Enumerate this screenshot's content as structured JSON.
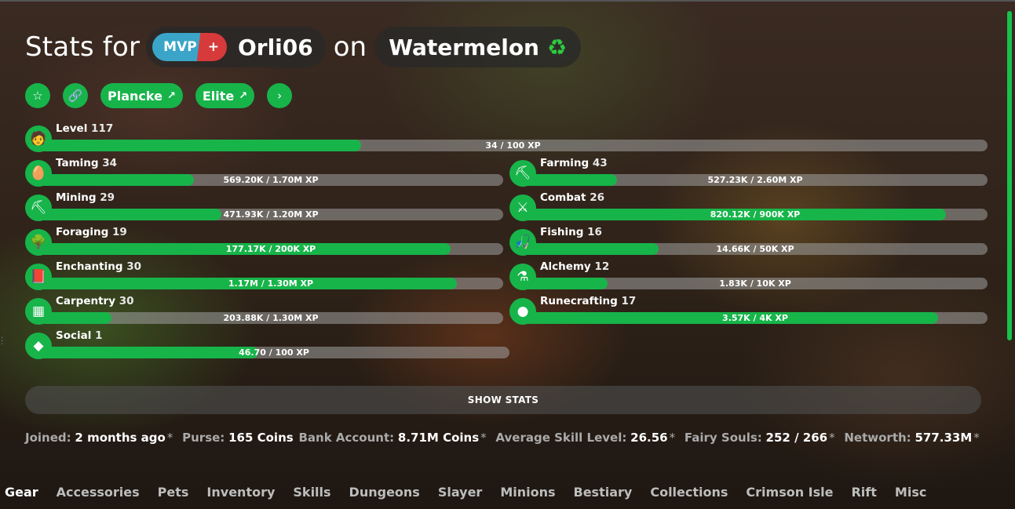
{
  "header": {
    "stats_for": "Stats for",
    "rank_main": "MVP",
    "rank_plus": "+",
    "player": "Orli06",
    "on": "on",
    "profile": "Watermelon",
    "profile_icon": "recycle-icon"
  },
  "buttons": [
    {
      "icon": "star-icon"
    },
    {
      "icon": "link-icon"
    },
    {
      "label": "Plancke"
    },
    {
      "label": "Elite"
    },
    {
      "icon": "chevron-right-icon"
    }
  ],
  "skills": {
    "level": {
      "name": "Level",
      "level": "117",
      "xp": "34 / 100 XP",
      "progress": 0.34
    },
    "taming": {
      "name": "Taming",
      "level": "34",
      "xp": "569.20K / 1.70M XP",
      "progress": 0.335
    },
    "farming": {
      "name": "Farming",
      "level": "43",
      "xp": "527.23K / 2.60M XP",
      "progress": 0.203
    },
    "mining": {
      "name": "Mining",
      "level": "29",
      "xp": "471.93K / 1.20M XP",
      "progress": 0.393
    },
    "combat": {
      "name": "Combat",
      "level": "26",
      "xp": "820.12K / 900K XP",
      "progress": 0.911
    },
    "foraging": {
      "name": "Foraging",
      "level": "19",
      "xp": "177.17K / 200K XP",
      "progress": 0.886
    },
    "fishing": {
      "name": "Fishing",
      "level": "16",
      "xp": "14.66K / 50K XP",
      "progress": 0.293
    },
    "enchanting": {
      "name": "Enchanting",
      "level": "30",
      "xp": "1.17M / 1.30M XP",
      "progress": 0.9
    },
    "alchemy": {
      "name": "Alchemy",
      "level": "12",
      "xp": "1.83K / 10K XP",
      "progress": 0.183
    },
    "carpentry": {
      "name": "Carpentry",
      "level": "30",
      "xp": "203.88K / 1.30M XP",
      "progress": 0.157
    },
    "runecrafting": {
      "name": "Runecrafting",
      "level": "17",
      "xp": "3.57K / 4K XP",
      "progress": 0.893
    },
    "social": {
      "name": "Social",
      "level": "1",
      "xp": "46.70 / 100 XP",
      "progress": 0.467
    }
  },
  "show_stats": "SHOW STATS",
  "info": {
    "joined_label": "Joined:",
    "joined": "2 months ago",
    "purse_label": "Purse:",
    "purse": "165 Coins",
    "bank_label": "Bank Account:",
    "bank": "8.71M Coins",
    "avg_label": "Average Skill Level:",
    "avg": "26.56",
    "fairy_label": "Fairy Souls:",
    "fairy": "252 / 266",
    "networth_label": "Networth:",
    "networth": "577.33M",
    "asterisk": "*"
  },
  "tabs": [
    "Gear",
    "Accessories",
    "Pets",
    "Inventory",
    "Skills",
    "Dungeons",
    "Slayer",
    "Minions",
    "Bestiary",
    "Collections",
    "Crimson Isle",
    "Rift",
    "Misc"
  ]
}
